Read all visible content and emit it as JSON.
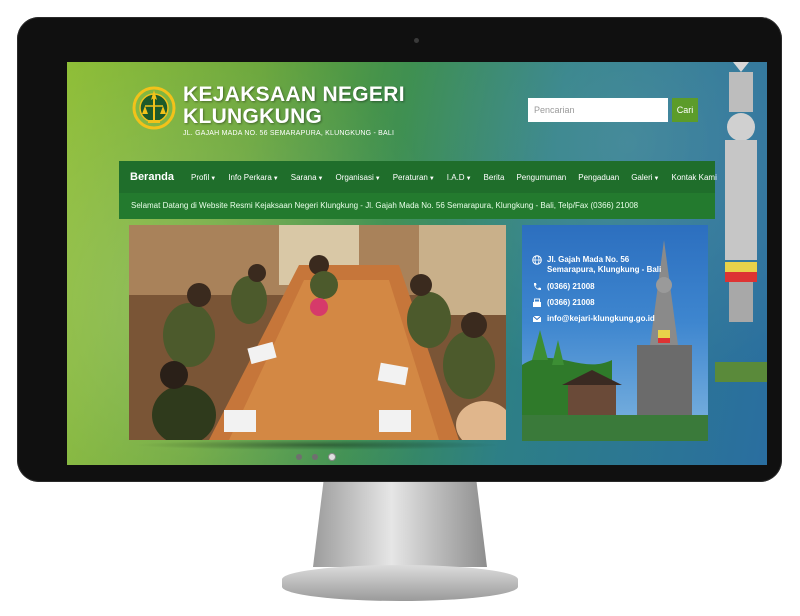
{
  "header": {
    "title_line1": "KEJAKSAAN NEGERI",
    "title_line2": "KLUNGKUNG",
    "address": "JL. GAJAH MADA NO. 56 SEMARAPURA, KLUNGKUNG - BALI"
  },
  "search": {
    "placeholder": "Pencarian",
    "button_label": "Cari"
  },
  "nav": {
    "brand": "Beranda",
    "items": [
      {
        "label": "Profil",
        "dropdown": true
      },
      {
        "label": "Info Perkara",
        "dropdown": true
      },
      {
        "label": "Sarana",
        "dropdown": true
      },
      {
        "label": "Organisasi",
        "dropdown": true
      },
      {
        "label": "Peraturan",
        "dropdown": true
      },
      {
        "label": "I.A.D",
        "dropdown": true
      },
      {
        "label": "Berita",
        "dropdown": false
      },
      {
        "label": "Pengumuman",
        "dropdown": false
      },
      {
        "label": "Pengaduan",
        "dropdown": false
      },
      {
        "label": "Galeri",
        "dropdown": true
      },
      {
        "label": "Kontak Kami",
        "dropdown": false
      }
    ]
  },
  "marquee": {
    "text": "Selamat Datang di Website Resmi Kejaksaan Negeri Klungkung - Jl. Gajah Mada No. 56 Semarapura, Klungkung - Bali, Telp/Fax (0366) 21008"
  },
  "slider": {
    "slide_count": 3,
    "active_index": 2
  },
  "contact": {
    "address_line1": "Jl. Gajah Mada No. 56",
    "address_line2": "Semarapura, Klungkung - Bali",
    "phone": "(0366) 21008",
    "fax": "(0366) 21008",
    "email": "info@kejari-klungkung.go.id"
  },
  "colors": {
    "nav_bg": "#1f6e2b",
    "marquee_bg": "#237a2e",
    "search_button": "#5c9c2a",
    "card_blue": "#2c6fbf"
  }
}
